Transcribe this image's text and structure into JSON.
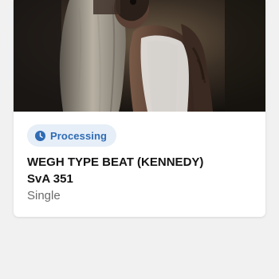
{
  "card": {
    "cover_image": "album-cover-image",
    "status": {
      "label": "Processing",
      "icon": "clock-icon",
      "text_color": "#2f6cb5",
      "background_color": "#e6eef8"
    },
    "title": "WEGH TYPE BEAT (KENNEDY)",
    "artist": "SvA 351",
    "release_type": "Single"
  }
}
